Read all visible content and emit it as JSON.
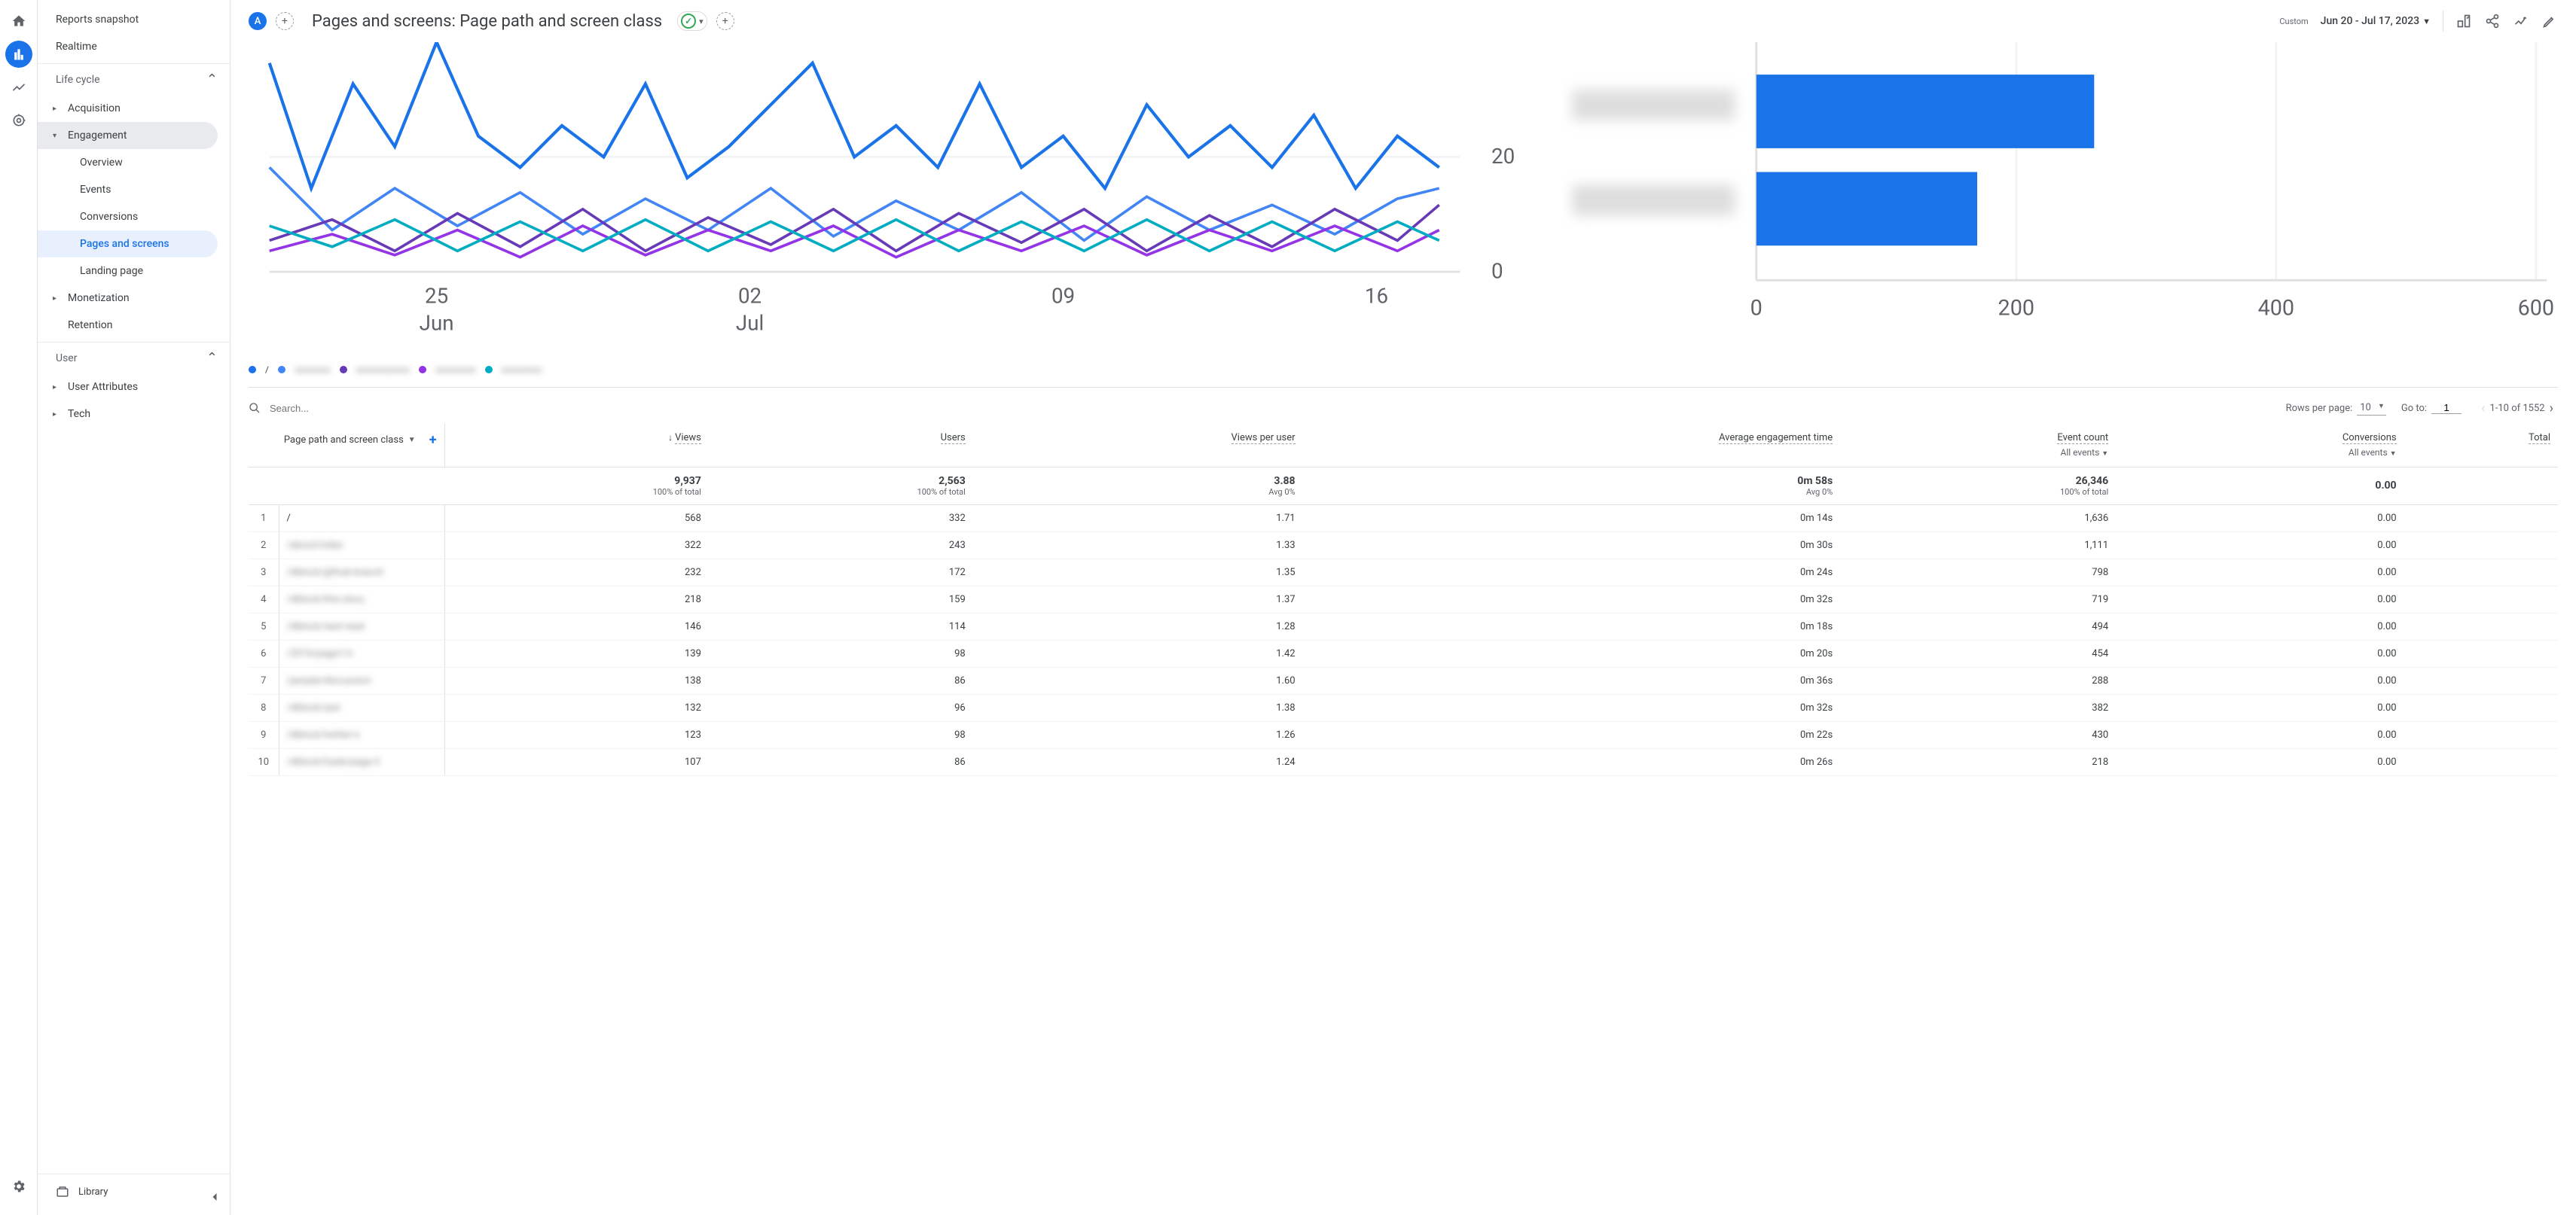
{
  "rail": {
    "avatar_letter": "A"
  },
  "sidebar": {
    "reports_snapshot": "Reports snapshot",
    "realtime": "Realtime",
    "life_cycle": "Life cycle",
    "acquisition": "Acquisition",
    "engagement": "Engagement",
    "eng_overview": "Overview",
    "eng_events": "Events",
    "eng_conversions": "Conversions",
    "eng_pages": "Pages and screens",
    "eng_landing": "Landing page",
    "monetization": "Monetization",
    "retention": "Retention",
    "user": "User",
    "user_attributes": "User Attributes",
    "tech": "Tech",
    "library": "Library"
  },
  "header": {
    "title": "Pages and screens: Page path and screen class",
    "custom_label": "Custom",
    "date_range": "Jun 20 - Jul 17, 2023"
  },
  "line_chart": {
    "y_ticks": [
      "20",
      "0"
    ],
    "x_ticks": [
      "25",
      "Jun",
      "02",
      "Jul",
      "09",
      "16"
    ],
    "legend_first": "/"
  },
  "bar_chart": {
    "x_ticks": [
      "0",
      "200",
      "400",
      "600"
    ],
    "bars": [
      {
        "value": 260
      },
      {
        "value": 170
      }
    ]
  },
  "controls": {
    "search_placeholder": "Search...",
    "rows_per_page_label": "Rows per page:",
    "rows_per_page_value": "10",
    "goto_label": "Go to:",
    "goto_value": "1",
    "range_text": "1-10 of 1552"
  },
  "table": {
    "dim_header": "Page path and screen class",
    "columns": {
      "views": "Views",
      "users": "Users",
      "vpu": "Views per user",
      "aet": "Average engagement time",
      "events": "Event count",
      "events_sub": "All events",
      "conv": "Conversions",
      "conv_sub": "All events",
      "total": "Total"
    },
    "totals": {
      "views": "9,937",
      "views_sub": "100% of total",
      "users": "2,563",
      "users_sub": "100% of total",
      "vpu": "3.88",
      "vpu_sub": "Avg 0%",
      "aet": "0m 58s",
      "aet_sub": "Avg 0%",
      "events": "26,346",
      "events_sub": "100% of total",
      "conv": "0.00"
    },
    "rows": [
      {
        "idx": "1",
        "path": "/",
        "blur": false,
        "views": "568",
        "users": "332",
        "vpu": "1.71",
        "aet": "0m 14s",
        "events": "1,636",
        "conv": "0.00"
      },
      {
        "idx": "2",
        "path": "/about/index",
        "blur": true,
        "views": "322",
        "users": "243",
        "vpu": "1.33",
        "aet": "0m 30s",
        "events": "1,111",
        "conv": "0.00"
      },
      {
        "idx": "3",
        "path": "/dblock/github-branch",
        "blur": true,
        "views": "232",
        "users": "172",
        "vpu": "1.35",
        "aet": "0m 24s",
        "events": "798",
        "conv": "0.00"
      },
      {
        "idx": "4",
        "path": "/dblock/this-story",
        "blur": true,
        "views": "218",
        "users": "159",
        "vpu": "1.37",
        "aet": "0m 32s",
        "events": "719",
        "conv": "0.00"
      },
      {
        "idx": "5",
        "path": "/dblock/next-read",
        "blur": true,
        "views": "146",
        "users": "114",
        "vpu": "1.28",
        "aet": "0m 18s",
        "events": "494",
        "conv": "0.00"
      },
      {
        "idx": "6",
        "path": "/2016/page1/n",
        "blur": true,
        "views": "139",
        "users": "98",
        "vpu": "1.42",
        "aet": "0m 20s",
        "events": "454",
        "conv": "0.00"
      },
      {
        "idx": "7",
        "path": "/people/discussion",
        "blur": true,
        "views": "138",
        "users": "86",
        "vpu": "1.60",
        "aet": "0m 36s",
        "events": "288",
        "conv": "0.00"
      },
      {
        "idx": "8",
        "path": "/dblock/asd",
        "blur": true,
        "views": "132",
        "users": "96",
        "vpu": "1.38",
        "aet": "0m 32s",
        "events": "382",
        "conv": "0.00"
      },
      {
        "idx": "9",
        "path": "/dblock/twitter-n",
        "blur": true,
        "views": "123",
        "users": "98",
        "vpu": "1.26",
        "aet": "0m 22s",
        "events": "430",
        "conv": "0.00"
      },
      {
        "idx": "10",
        "path": "/dblock/trade/page-3",
        "blur": true,
        "views": "107",
        "users": "86",
        "vpu": "1.24",
        "aet": "0m 26s",
        "events": "218",
        "conv": "0.00"
      }
    ]
  },
  "chart_data": {
    "line": {
      "type": "line",
      "xlabel": "",
      "ylabel": "",
      "x_range": [
        "2023-06-20",
        "2023-07-17"
      ],
      "ylim": [
        0,
        60
      ],
      "x_ticks": [
        "Jun 25",
        "Jul 02",
        "Jul 09",
        "Jul 16"
      ],
      "series_count": 5,
      "note": "Five page-path series; series 1 is '/'. Values fluctuate roughly between 5 and 55 views/day."
    },
    "bar": {
      "type": "bar",
      "orientation": "horizontal",
      "xlim": [
        0,
        600
      ],
      "x_ticks": [
        0,
        200,
        400,
        600
      ],
      "bars": [
        {
          "label": "(redacted)",
          "value": 260
        },
        {
          "label": "(redacted)",
          "value": 170
        }
      ]
    }
  }
}
